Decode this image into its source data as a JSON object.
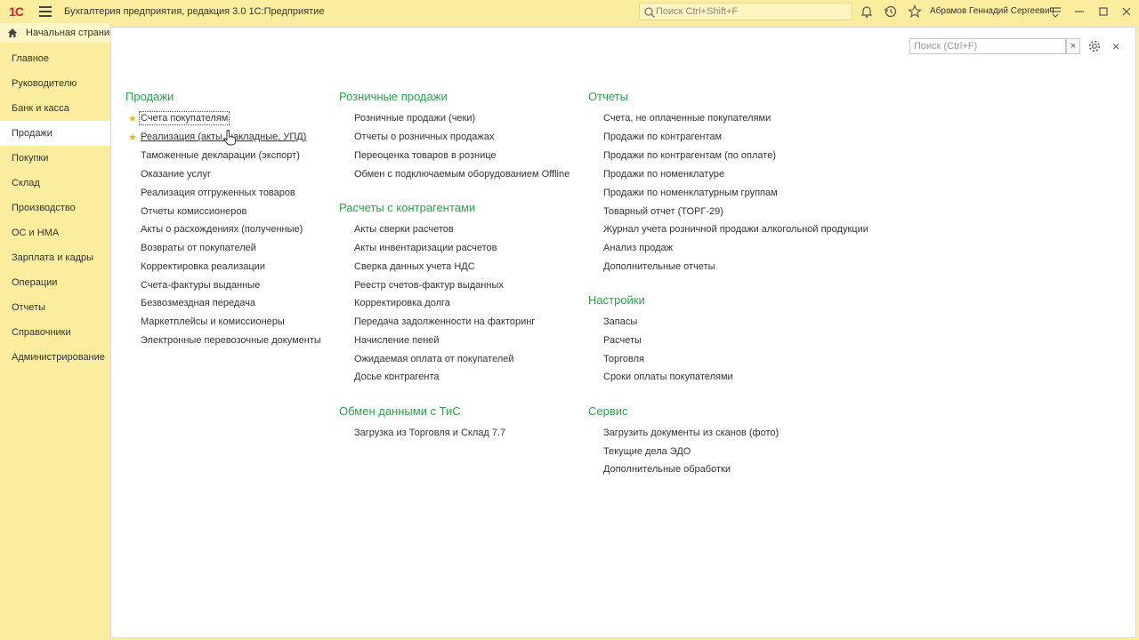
{
  "titlebar": {
    "logo": "1С",
    "app_title": "Бухгалтерия предприятия, редакция 3.0 1С:Предприятие",
    "search_placeholder": "Поиск Ctrl+Shift+F",
    "user_name": "Абрамов Геннадий Сергеевич",
    "icons": [
      "menu-icon",
      "search-icon",
      "bell-icon",
      "history-icon",
      "star-icon",
      "more-icon",
      "minimize-icon",
      "maximize-icon",
      "close-icon"
    ]
  },
  "home_tab": {
    "label": "Начальная страница"
  },
  "sidebar": {
    "items": [
      {
        "label": "Главное"
      },
      {
        "label": "Руководителю"
      },
      {
        "label": "Банк и касса"
      },
      {
        "label": "Продажи",
        "active": true
      },
      {
        "label": "Покупки"
      },
      {
        "label": "Склад"
      },
      {
        "label": "Производство"
      },
      {
        "label": "ОС и НМА"
      },
      {
        "label": "Зарплата и кадры"
      },
      {
        "label": "Операции"
      },
      {
        "label": "Отчеты"
      },
      {
        "label": "Справочники"
      },
      {
        "label": "Администрирование"
      }
    ]
  },
  "panel": {
    "search_placeholder": "Поиск (Ctrl+F)",
    "clear_label": "×",
    "close_label": "×"
  },
  "sections": {
    "prodazhi": {
      "title": "Продажи",
      "items": [
        "Счета покупателям",
        "Реализация (акты, накладные, УПД)",
        "Таможенные декларации (экспорт)",
        "Оказание услуг",
        "Реализация отгруженных товаров",
        "Отчеты комиссионеров",
        "Акты о расхождениях (полученные)",
        "Возвраты от покупателей",
        "Корректировка реализации",
        "Счета-фактуры выданные",
        "Безвозмездная передача",
        "Маркетплейсы и комиссионеры",
        "Электронные перевозочные документы"
      ]
    },
    "roznica": {
      "title": "Розничные продажи",
      "items": [
        "Розничные продажи (чеки)",
        "Отчеты о розничных продажах",
        "Переоценка товаров в рознице",
        "Обмен с подключаемым оборудованием Offline"
      ]
    },
    "raschety": {
      "title": "Расчеты с контрагентами",
      "items": [
        "Акты сверки расчетов",
        "Акты инвентаризации расчетов",
        "Сверка данных учета НДС",
        "Реестр счетов-фактур выданных",
        "Корректировка долга",
        "Передача задолженности на факторинг",
        "Начисление пеней",
        "Ожидаемая оплата от покупателей",
        "Досье контрагента"
      ]
    },
    "obmen": {
      "title": "Обмен данными с ТиС",
      "items": [
        "Загрузка из Торговля и Склад 7.7"
      ]
    },
    "otchety": {
      "title": "Отчеты",
      "items": [
        "Счета, не оплаченные покупателями",
        "Продажи по контрагентам",
        "Продажи по контрагентам (по оплате)",
        "Продажи по номенклатуре",
        "Продажи по номенклатурным группам",
        "Товарный отчет (ТОРГ-29)",
        "Журнал учета розничной продажи алкогольной продукции",
        "Анализ продаж",
        "Дополнительные отчеты"
      ]
    },
    "nastroiki": {
      "title": "Настройки",
      "items": [
        "Запасы",
        "Расчеты",
        "Торговля",
        "Сроки оплаты покупателями"
      ]
    },
    "servis": {
      "title": "Сервис",
      "items": [
        "Загрузить документы из сканов (фото)",
        "Текущие дела ЭДО",
        "Дополнительные обработки"
      ]
    }
  },
  "colors": {
    "accent": "#2ba149",
    "sidebar_bg": "#fbed9e",
    "star": "#f0b31c"
  }
}
